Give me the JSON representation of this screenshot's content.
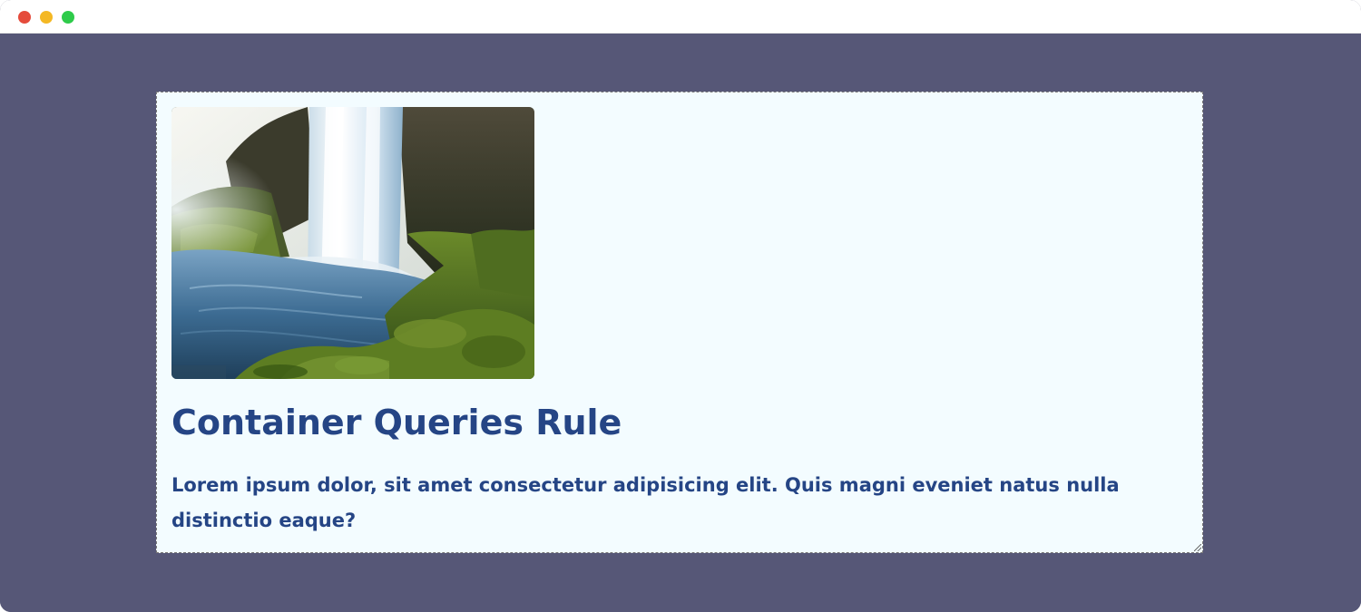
{
  "window": {
    "controls": [
      {
        "name": "close",
        "color": "#e54b3b"
      },
      {
        "name": "minimize",
        "color": "#f4b824"
      },
      {
        "name": "zoom",
        "color": "#2ecb4a"
      }
    ],
    "background_color": "#565777"
  },
  "card": {
    "background_color": "#f3fcff",
    "border_style": "dashed",
    "image": {
      "subject": "waterfall-photo",
      "description_icon": "waterfall-image"
    },
    "title": "Container Queries Rule",
    "text": "Lorem ipsum dolor, sit amet consectetur adipisicing elit. Quis magni eveniet natus nulla distinctio eaque?",
    "text_color": "#254585"
  }
}
